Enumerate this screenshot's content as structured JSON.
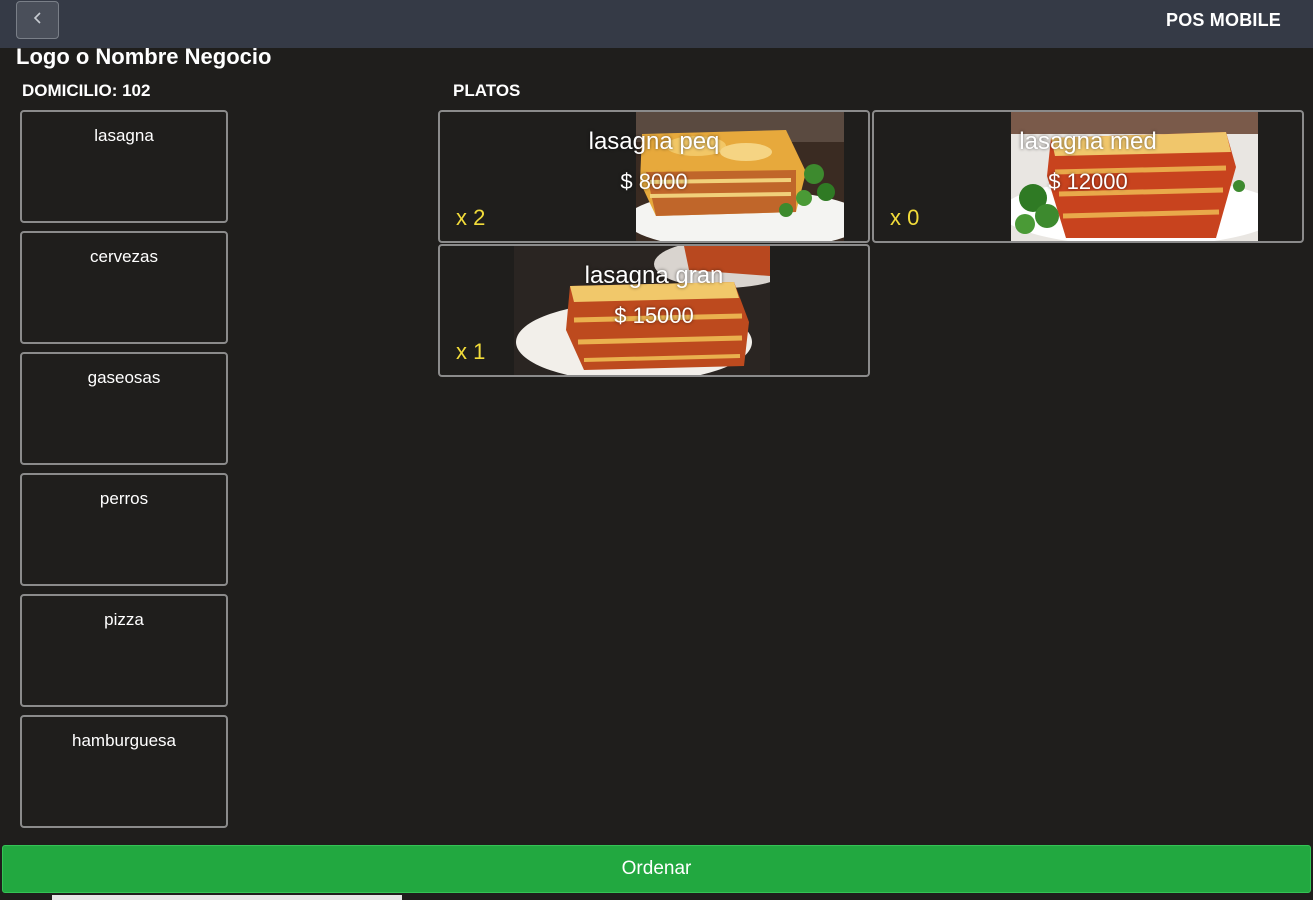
{
  "header": {
    "back_icon": "chevron-left-icon",
    "app_title": "POS MOBILE"
  },
  "business": {
    "name": "Logo o Nombre Negocio"
  },
  "order": {
    "label": "DOMICILIO: 102"
  },
  "categories": [
    {
      "label": "lasagna"
    },
    {
      "label": "cervezas"
    },
    {
      "label": "gaseosas"
    },
    {
      "label": "perros"
    },
    {
      "label": "pizza"
    },
    {
      "label": "hamburguesa"
    }
  ],
  "dishes_section": {
    "label": "PLATOS"
  },
  "dishes": [
    {
      "name": "lasagna peq",
      "price": "$ 8000",
      "qty": "x 2"
    },
    {
      "name": "lasagna med",
      "price": "$ 12000",
      "qty": "x 0"
    },
    {
      "name": "lasagna gran",
      "price": "$ 15000",
      "qty": "x 1"
    }
  ],
  "footer": {
    "order_button": "Ordenar"
  },
  "colors": {
    "background": "#1f1e1c",
    "topbar": "#353a46",
    "accent_green": "#22a840",
    "qty_yellow": "#f2dc3a",
    "card_border": "#8b8b8b"
  }
}
